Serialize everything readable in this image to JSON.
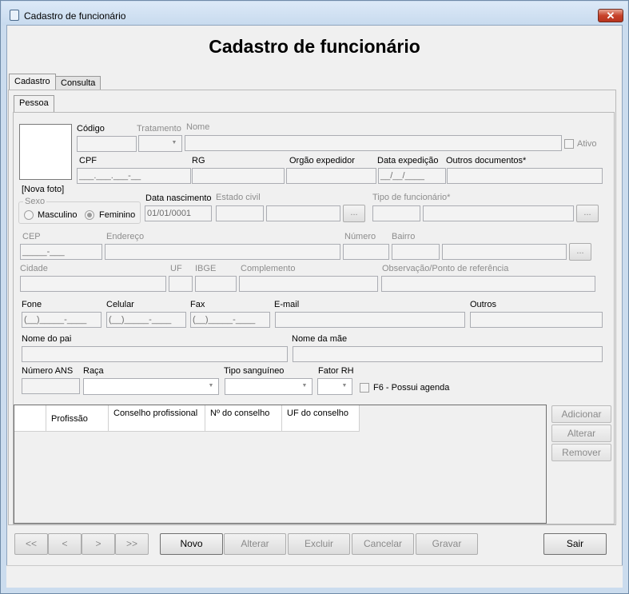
{
  "window": {
    "title": "Cadastro de funcionário",
    "close_label": "✕"
  },
  "heading": "Cadastro de funcionário",
  "tabs": [
    "Cadastro",
    "Consulta"
  ],
  "subtab": "Pessoa",
  "photo_label": "[Nova foto]",
  "labels": {
    "codigo": "Código",
    "tratamento": "Tratamento",
    "nome": "Nome",
    "ativo": "Ativo",
    "cpf": "CPF",
    "rg": "RG",
    "orgao": "Orgão expedidor",
    "data_exp": "Data expedição",
    "outros_docs": "Outros documentos*",
    "sexo": "Sexo",
    "masculino": "Masculino",
    "feminino": "Feminino",
    "data_nasc": "Data nascimento",
    "estado_civil": "Estado civil",
    "tipo_func": "Tipo de funcionário*",
    "cep": "CEP",
    "endereco": "Endereço",
    "numero": "Número",
    "bairro": "Bairro",
    "cidade": "Cidade",
    "uf": "UF",
    "ibge": "IBGE",
    "complemento": "Complemento",
    "observacao": "Observação/Ponto de referência",
    "fone": "Fone",
    "celular": "Celular",
    "fax": "Fax",
    "email": "E-mail",
    "outros": "Outros",
    "nome_pai": "Nome do pai",
    "nome_mae": "Nome da mãe",
    "numero_ans": "Número ANS",
    "raca": "Raça",
    "tipo_sang": "Tipo sanguíneo",
    "fator_rh": "Fator RH",
    "possui_agenda": "F6 - Possui agenda"
  },
  "values": {
    "cpf": "___.___.___-__",
    "data_exp": "__/__/____",
    "data_nasc": "01/01/0001",
    "cep": "_____-___",
    "fone": "(__)_____-____",
    "celular": "(__)_____-____",
    "fax": "(__)_____-____"
  },
  "dots": "...",
  "grid": {
    "columns": [
      "Profissão",
      "Conselho profissional",
      "Nº do conselho",
      "UF do conselho"
    ]
  },
  "side_buttons": [
    "Adicionar",
    "Alterar",
    "Remover"
  ],
  "nav_buttons": [
    "<<",
    "<",
    ">",
    ">>"
  ],
  "action_buttons": [
    "Novo",
    "Alterar",
    "Excluir",
    "Cancelar",
    "Gravar"
  ],
  "exit_button": "Sair"
}
